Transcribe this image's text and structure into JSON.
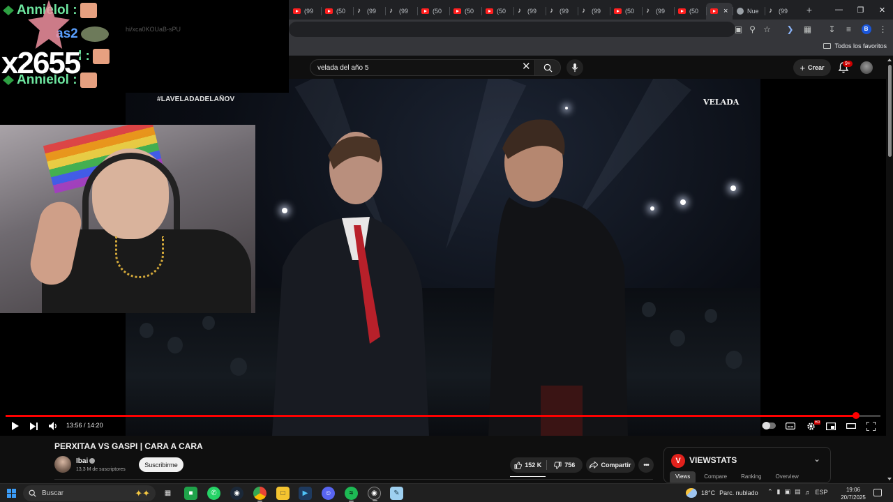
{
  "browser": {
    "tabs": [
      {
        "icon": "youtube",
        "label": "(99"
      },
      {
        "icon": "youtube",
        "label": "(50"
      },
      {
        "icon": "tiktok",
        "label": "(99"
      },
      {
        "icon": "tiktok",
        "label": "(99"
      },
      {
        "icon": "youtube",
        "label": "(50"
      },
      {
        "icon": "youtube",
        "label": "(50"
      },
      {
        "icon": "youtube",
        "label": "(50"
      },
      {
        "icon": "tiktok",
        "label": "(99"
      },
      {
        "icon": "tiktok",
        "label": "(99"
      },
      {
        "icon": "tiktok",
        "label": "(99"
      },
      {
        "icon": "youtube",
        "label": "(50"
      },
      {
        "icon": "tiktok",
        "label": "(99"
      },
      {
        "icon": "youtube",
        "label": "(50"
      },
      {
        "icon": "youtube",
        "label": "",
        "active": true
      },
      {
        "icon": "globe",
        "label": "Nue"
      },
      {
        "icon": "tiktok",
        "label": "(99"
      }
    ],
    "new_tab_label": "+",
    "bookmarks_folder": "Todos los favoritos",
    "profile_initial": "B"
  },
  "youtube": {
    "search_query": "velada del año 5",
    "create_label": "Crear",
    "notification_count": "9+"
  },
  "overlay": {
    "chat_lines": [
      {
        "user": "Annielol :"
      },
      {
        "user": "as2"
      },
      {
        "user": "l :"
      },
      {
        "user": "Annielol :"
      }
    ],
    "combo_count": "x2655",
    "chat_ghost_text": "hi/xca0KOUaB-sPU",
    "hashtag": "#LAVELADADELAÑOV",
    "event_logo": "VELADA"
  },
  "player": {
    "current_time": "13:56",
    "duration": "14:20",
    "time_separator": " / ",
    "progress_fraction": 0.972,
    "hd_badge": "HD"
  },
  "video_info": {
    "title": "PERXITAA VS GASPI | CARA A CARA",
    "channel_name": "Ibai",
    "subscribers": "13,3 M de suscriptores",
    "subscribe_label": "Suscribirme",
    "likes": "152 K",
    "dislikes": "756",
    "share_label": "Compartir"
  },
  "viewstats": {
    "logo_letter": "V",
    "title": "VIEWSTATS",
    "tabs": [
      "Views",
      "Compare",
      "Ranking",
      "Overview"
    ],
    "active_tab": "Views"
  },
  "taskbar": {
    "search_placeholder": "Buscar",
    "weather_temp": "18°C",
    "weather_desc": "Parc. nublado",
    "language": "ESP",
    "time": "19:06",
    "date": "20/7/2025"
  },
  "colors": {
    "youtube_red": "#ff0000",
    "background": "#0f0f0f",
    "chat_green": "#6ee7a0",
    "viewstats_red": "#e2211c"
  }
}
